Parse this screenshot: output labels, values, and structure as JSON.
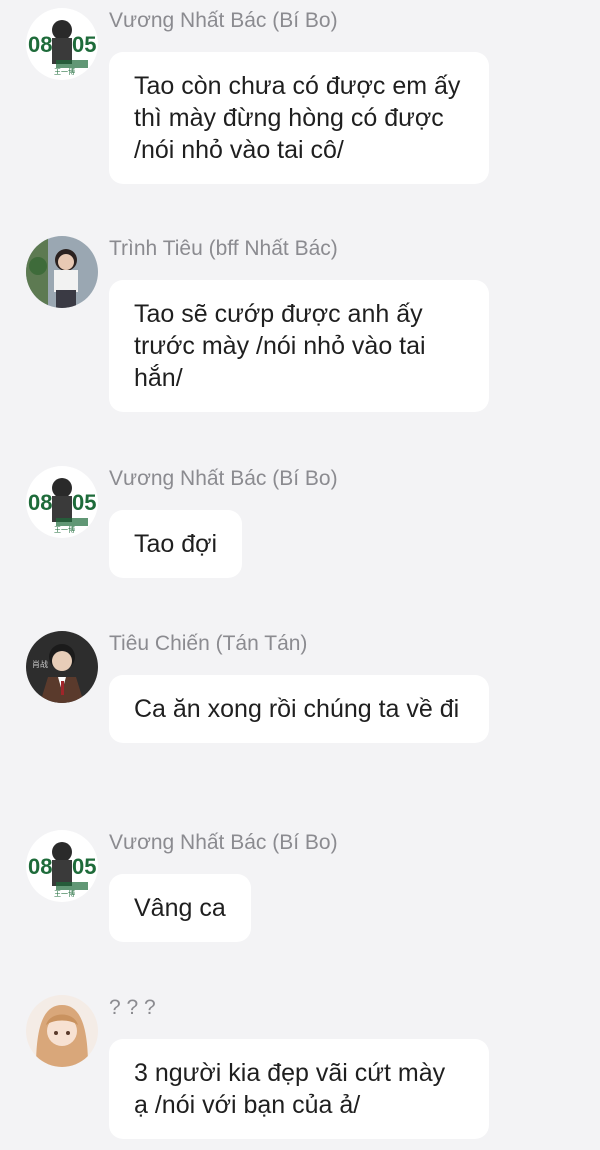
{
  "messages": [
    {
      "sender": "Vương Nhất Bác (Bí Bo)",
      "text": "Tao còn chưa có được em ấy thì mày đừng hòng có được /nói nhỏ vào tai cô/",
      "avatar_icon": "user-avatar-icon"
    },
    {
      "sender": "Trình Tiêu (bff Nhất Bác)",
      "text": "Tao sẽ cướp được anh ấy trước mày /nói nhỏ vào tai hắn/",
      "avatar_icon": "user-avatar-icon"
    },
    {
      "sender": "Vương Nhất Bác (Bí Bo)",
      "text": "Tao đợi",
      "avatar_icon": "user-avatar-icon"
    },
    {
      "sender": "Tiêu Chiến (Tán Tán)",
      "text": "Ca ăn xong rồi chúng ta về đi",
      "avatar_icon": "user-avatar-icon"
    },
    {
      "sender": "Vương Nhất Bác (Bí Bo)",
      "text": "Vâng ca",
      "avatar_icon": "user-avatar-icon"
    },
    {
      "sender": "? ? ?",
      "text": "3 người kia đẹp vãi cứt mày ạ /nói với bạn của ả/",
      "avatar_icon": "user-avatar-icon"
    }
  ],
  "colors": {
    "background": "#f3f3f5",
    "bubble": "#ffffff",
    "sender_name": "#8b8b90",
    "message_text": "#1f1f1f"
  }
}
